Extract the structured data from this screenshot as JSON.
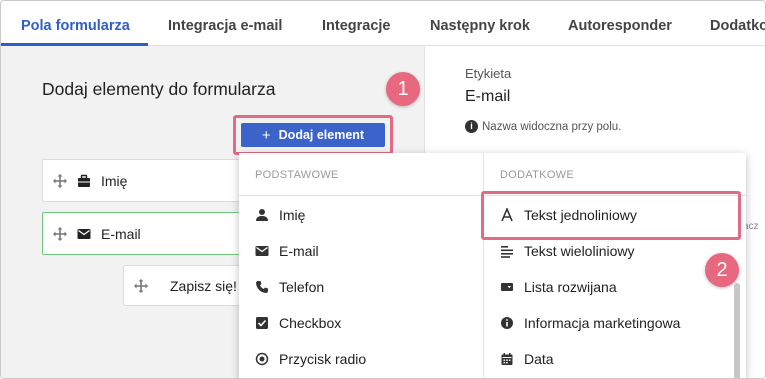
{
  "tabs": [
    {
      "label": "Pola formularza",
      "active": true
    },
    {
      "label": "Integracja e-mail"
    },
    {
      "label": "Integracje"
    },
    {
      "label": "Następny krok"
    },
    {
      "label": "Autoresponder"
    },
    {
      "label": "Dodatko"
    }
  ],
  "left": {
    "title": "Dodaj elementy do formularza",
    "add_button": "Dodaj element",
    "fields": [
      {
        "label": "Imię",
        "icon": "briefcase-icon"
      },
      {
        "label": "E-mail",
        "icon": "envelope-icon"
      }
    ],
    "submit_label": "Zapisz się!"
  },
  "right": {
    "label": "Etykieta",
    "value": "E-mail",
    "hint": "Nazwa widoczna przy polu.",
    "clipped_text": "acz"
  },
  "menu": {
    "basic_header": "PODSTAWOWE",
    "extra_header": "DODATKOWE",
    "basic_items": [
      {
        "label": "Imię",
        "icon": "person-icon"
      },
      {
        "label": "E-mail",
        "icon": "envelope-icon"
      },
      {
        "label": "Telefon",
        "icon": "phone-icon"
      },
      {
        "label": "Checkbox",
        "icon": "checkbox-icon"
      },
      {
        "label": "Przycisk radio",
        "icon": "radio-icon"
      }
    ],
    "extra_items": [
      {
        "label": "Tekst jednoliniowy",
        "icon": "text-a-icon"
      },
      {
        "label": "Tekst wieloliniowy",
        "icon": "multiline-icon"
      },
      {
        "label": "Lista rozwijana",
        "icon": "dropdown-icon"
      },
      {
        "label": "Informacja marketingowa",
        "icon": "info-icon"
      },
      {
        "label": "Data",
        "icon": "calendar-icon"
      }
    ]
  },
  "callouts": [
    "1",
    "2"
  ],
  "colors": {
    "accent": "#2f5ec4",
    "button": "#3b63c9",
    "highlight": "#e36a82",
    "selected_border": "#6fc77d"
  }
}
